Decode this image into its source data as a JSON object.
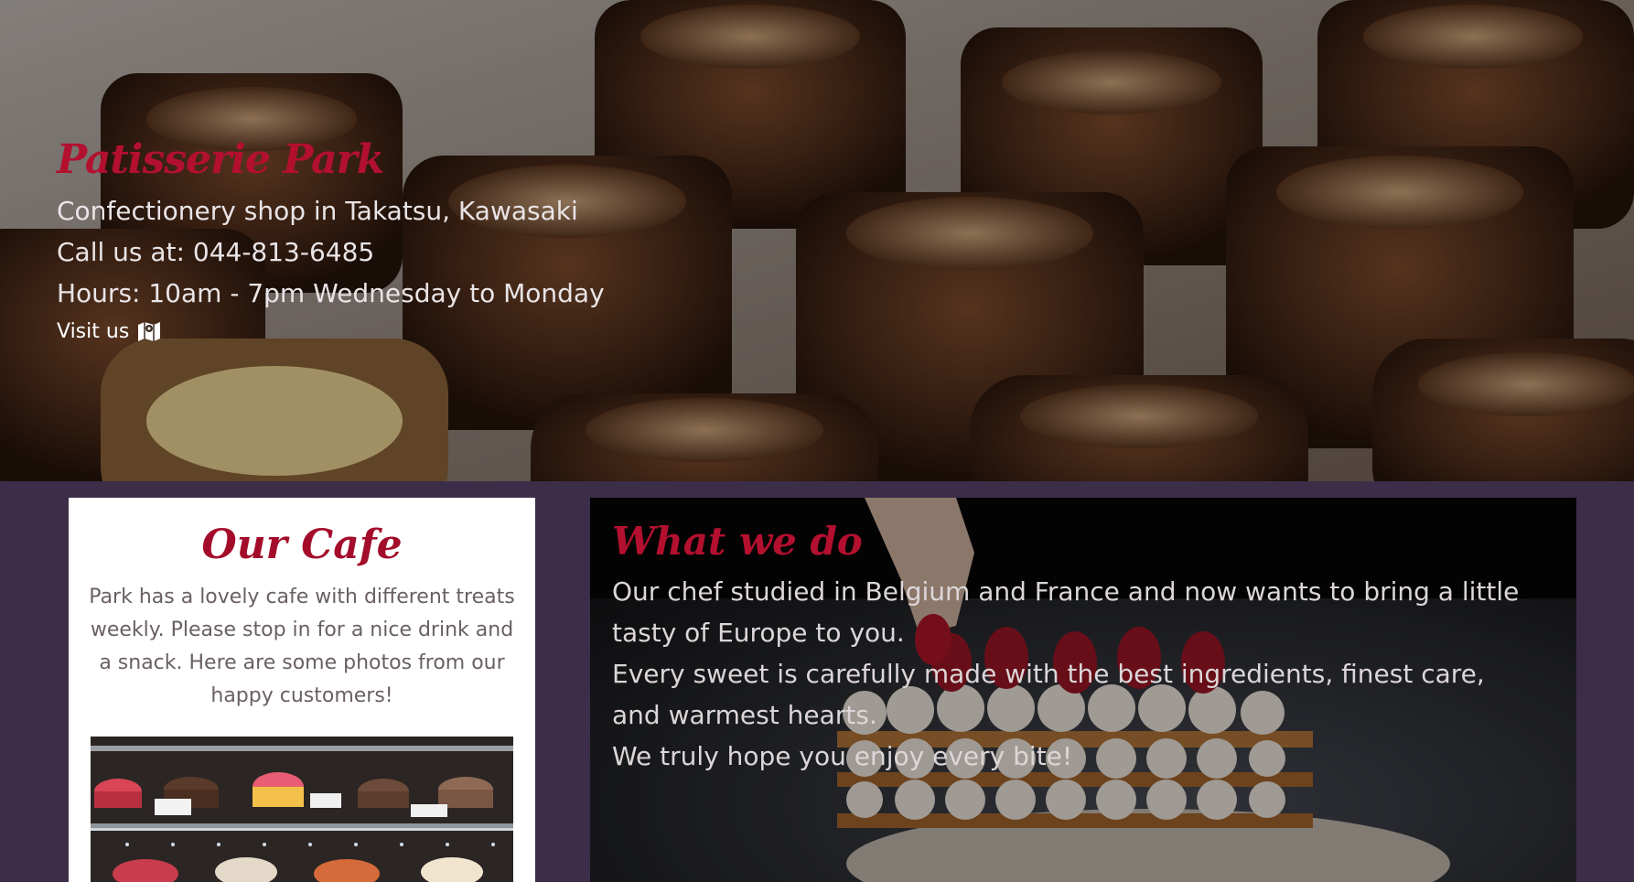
{
  "hero": {
    "brand": "Patisserie Park",
    "tagline": "Confectionery shop in Takatsu, Kawasaki",
    "phone_line": "Call us at: 044-813-6485",
    "hours_line": "Hours: 10am - 7pm Wednesday to Monday",
    "visit_label": "Visit us",
    "visit_icon": "map-icon"
  },
  "cafe": {
    "title": "Our Cafe",
    "description": "Park has a lovely cafe with different treats weekly. Please stop in for a nice drink and a snack. Here are some photos from our happy customers!"
  },
  "what": {
    "title": "What we do",
    "lines": [
      "Our chef studied in Belgium and France and now wants to bring a little tasty of Europe to you.",
      "Every sweet is carefully made with the best ingredients, finest care, and warmest hearts.",
      "We truly hope you enjoy every bite!"
    ]
  },
  "colors": {
    "brand_red": "#b3102f",
    "page_bg": "#3c2d49",
    "card_bg": "#ffffff"
  }
}
